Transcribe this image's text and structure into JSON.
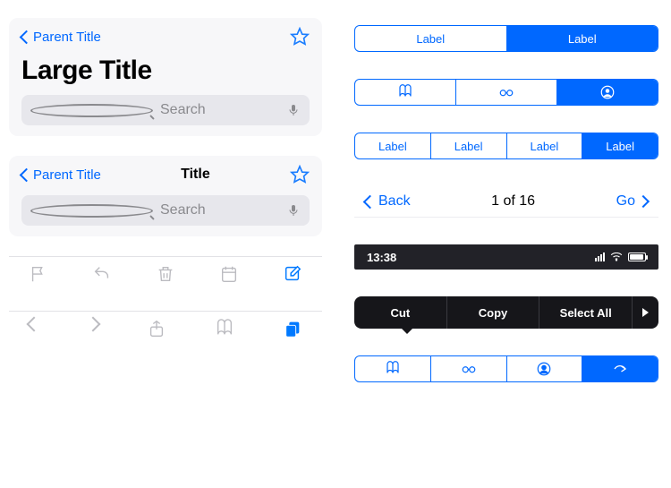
{
  "headerLarge": {
    "back": "Parent Title",
    "title": "Large Title",
    "searchPlaceholder": "Search"
  },
  "headerSmall": {
    "back": "Parent Title",
    "title": "Title",
    "searchPlaceholder": "Search"
  },
  "seg2": {
    "items": [
      "Label",
      "Label"
    ],
    "selected": 1
  },
  "seg3icons": {
    "selected": 2
  },
  "seg4": {
    "items": [
      "Label",
      "Label",
      "Label",
      "Label"
    ],
    "selected": 3
  },
  "pager": {
    "back": "Back",
    "count": "1 of 16",
    "go": "Go"
  },
  "status": {
    "time": "13:38"
  },
  "popover": {
    "items": [
      "Cut",
      "Copy",
      "Select All"
    ]
  },
  "tabbar": {
    "selected": 3
  }
}
